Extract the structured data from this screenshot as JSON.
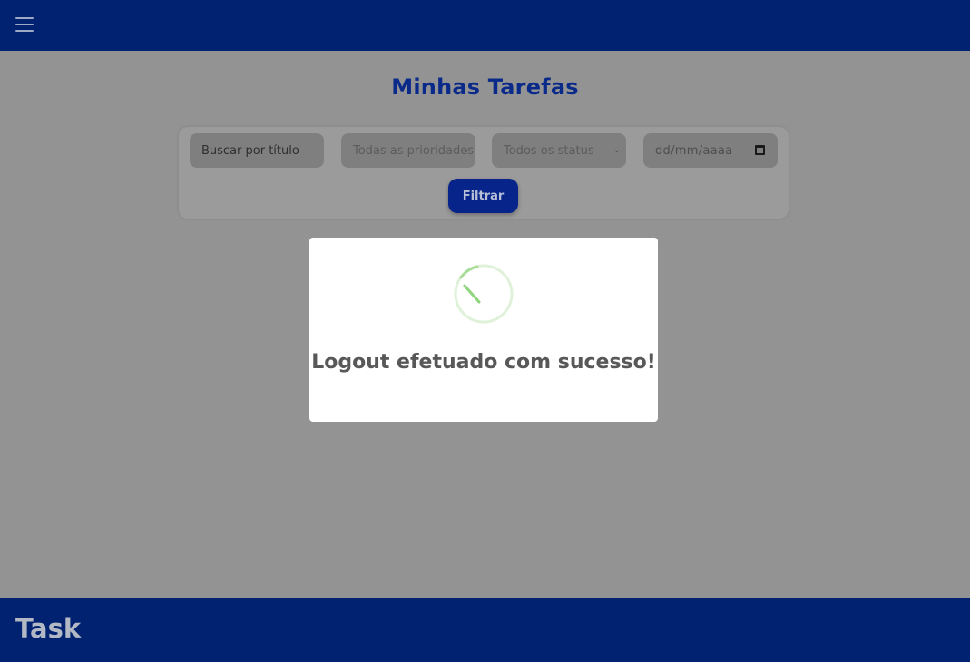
{
  "header": {
    "menu_icon": "hamburger-icon"
  },
  "main": {
    "title": "Minhas Tarefas",
    "filters": {
      "search_placeholder": "Buscar por título",
      "priority_selected": "Todas as prioridades",
      "status_selected": "Todos os status",
      "date_placeholder": "dd/mm/aaaa",
      "filter_button": "Filtrar"
    }
  },
  "modal": {
    "icon": "success-spinner-icon",
    "message": "Logout efetuado com sucesso!",
    "accent": "#9ad98a"
  },
  "footer": {
    "brand": "Task"
  },
  "colors": {
    "navbar": "#002271",
    "primary": "#06248a",
    "overlay": "#939393"
  }
}
